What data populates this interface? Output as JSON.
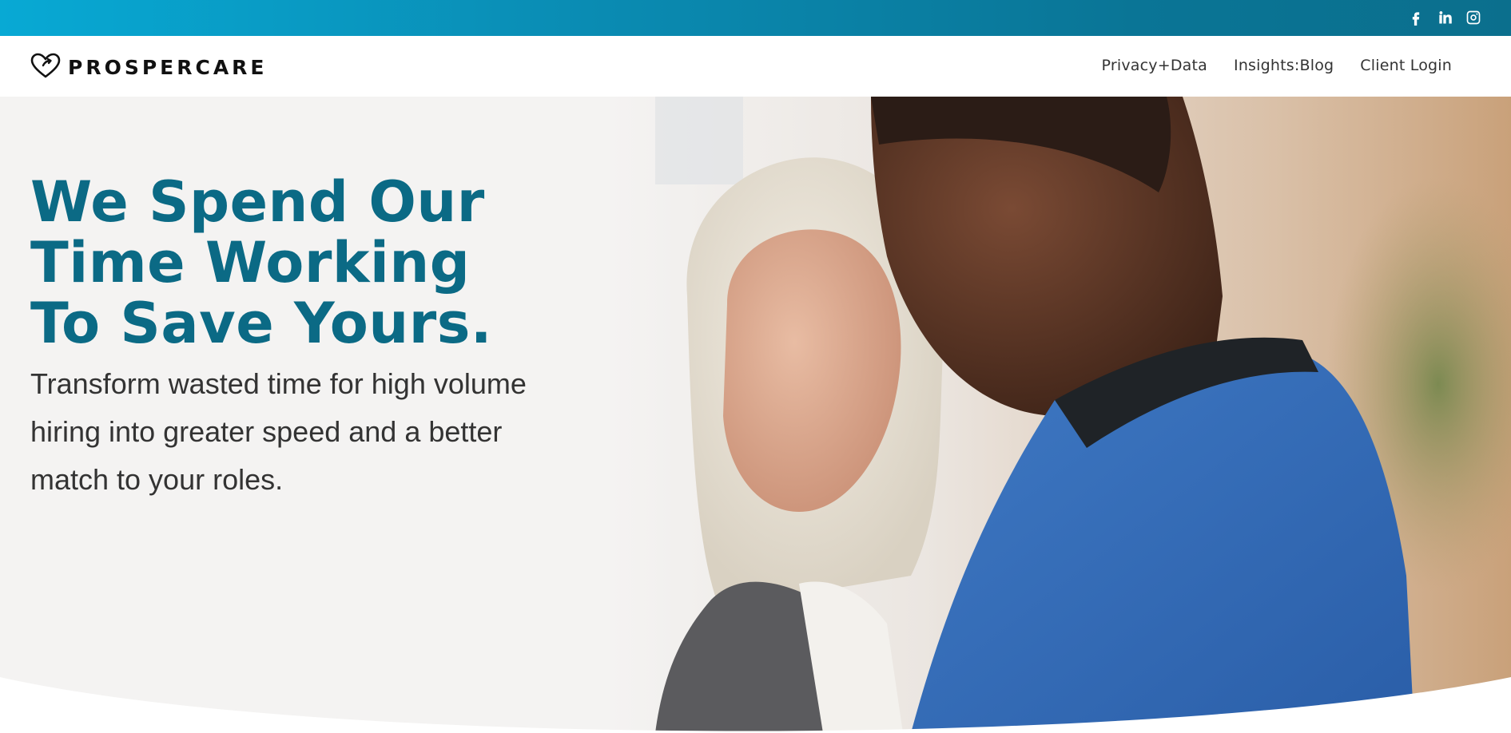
{
  "topbar": {
    "social": [
      {
        "icon": "facebook-icon",
        "label": "Facebook"
      },
      {
        "icon": "linkedin-icon",
        "label": "LinkedIn"
      },
      {
        "icon": "instagram-icon",
        "label": "Instagram"
      }
    ],
    "gradient": [
      "#08a9d4",
      "#0b6f8d"
    ]
  },
  "header": {
    "logo_text": "PROSPERCARE",
    "nav": [
      "Privacy+Data",
      "Insights:Blog",
      "Client Login"
    ]
  },
  "hero": {
    "headline_lines": [
      "We Spend Our",
      "Time Working",
      "To Save Yours."
    ],
    "subhead": "Transform wasted time for high volume hiring into greater speed and a better match to your roles.",
    "headline_color": "#0b6a85"
  }
}
